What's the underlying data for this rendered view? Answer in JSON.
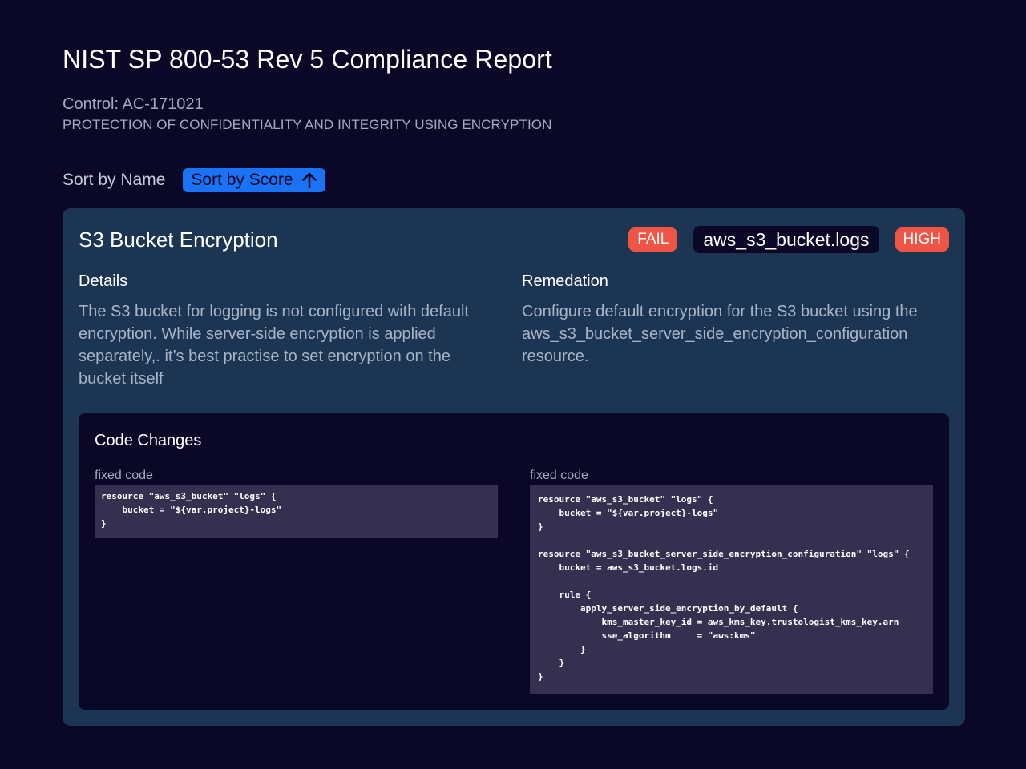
{
  "report": {
    "title": "NIST SP 800-53 Rev 5 Compliance Report",
    "control_id": "Control: AC-171021",
    "control_name": "PROTECTION OF CONFIDENTIALITY AND INTEGRITY USING ENCRYPTION"
  },
  "sort": {
    "by_name_label": "Sort by Name",
    "by_score_label": "Sort by Score",
    "score_icon": "arrow-up-icon",
    "active_color": "#1a73f4"
  },
  "finding": {
    "title": "S3 Bucket Encryption",
    "status": "FAIL",
    "resource": "aws_s3_bucket.logs",
    "severity": "HIGH",
    "badge_color": "#f05445",
    "details_heading": "Details",
    "details_text": "The S3 bucket for logging is not configured with default encryption. While server-side encryption is applied separately,. it’s best practise to set encryption on the bucket itself",
    "remediation_heading": "Remedation",
    "remediation_text": "Configure default encryption for the S3 bucket using the aws_s3_bucket_server_side_encryption_configuration resource."
  },
  "code_changes": {
    "title": "Code Changes",
    "left_label": "fixed code",
    "right_label": "fixed code",
    "left_code": "resource \"aws_s3_bucket\" \"logs\" {\n    bucket = \"${var.project}-logs\"\n}",
    "right_code": "resource \"aws_s3_bucket\" \"logs\" {\n    bucket = \"${var.project}-logs\"\n}\n\nresource \"aws_s3_bucket_server_side_encryption_configuration\" \"logs\" {\n    bucket = aws_s3_bucket.logs.id\n\n    rule {\n        apply_server_side_encryption_by_default {\n            kms_master_key_id = aws_kms_key.trustologist_kms_key.arn\n            sse_algorithm     = \"aws:kms\"\n        }\n    }\n}"
  }
}
